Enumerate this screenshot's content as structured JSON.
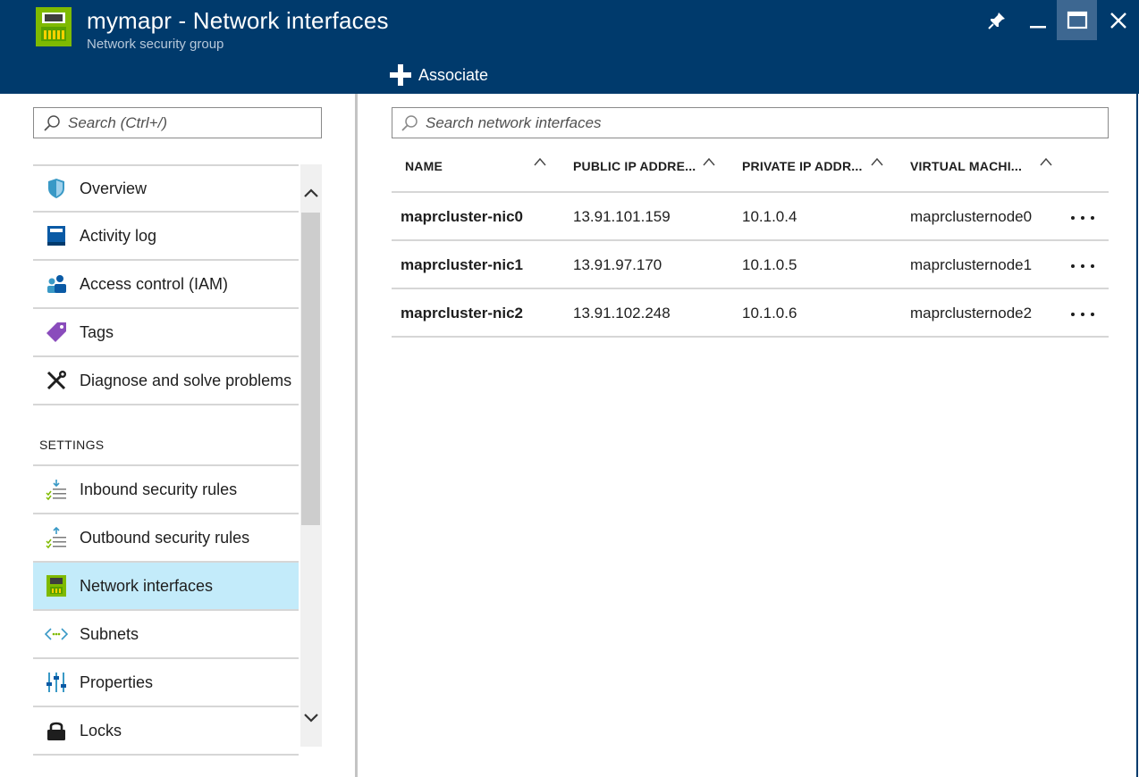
{
  "header": {
    "title": "mymapr - Network interfaces",
    "subtitle": "Network security group",
    "app_icon": "network-interface-icon",
    "window_controls": [
      "pin-icon",
      "minimize-icon",
      "maximize-icon",
      "close-icon"
    ],
    "command": {
      "label": "Associate",
      "icon": "plus-icon"
    }
  },
  "sidebar": {
    "search_placeholder": "Search (Ctrl+/)",
    "items": [
      {
        "label": "Overview",
        "icon": "shield-icon"
      },
      {
        "label": "Activity log",
        "icon": "activity-log-icon"
      },
      {
        "label": "Access control (IAM)",
        "icon": "users-icon"
      },
      {
        "label": "Tags",
        "icon": "tag-icon"
      },
      {
        "label": "Diagnose and solve problems",
        "icon": "wrench-icon"
      }
    ],
    "settings_header": "SETTINGS",
    "settings_items": [
      {
        "label": "Inbound security rules",
        "icon": "inbound-rules-icon"
      },
      {
        "label": "Outbound security rules",
        "icon": "outbound-rules-icon"
      },
      {
        "label": "Network interfaces",
        "icon": "network-interface-icon",
        "selected": true
      },
      {
        "label": "Subnets",
        "icon": "subnet-icon"
      },
      {
        "label": "Properties",
        "icon": "properties-icon"
      },
      {
        "label": "Locks",
        "icon": "lock-icon"
      }
    ]
  },
  "main": {
    "search_placeholder": "Search network interfaces",
    "columns": [
      "NAME",
      "PUBLIC IP ADDRE...",
      "PRIVATE IP ADDR...",
      "VIRTUAL MACHI..."
    ],
    "rows": [
      {
        "name": "maprcluster-nic0",
        "public_ip": "13.91.101.159",
        "private_ip": "10.1.0.4",
        "vm": "maprclusternode0"
      },
      {
        "name": "maprcluster-nic1",
        "public_ip": "13.91.97.170",
        "private_ip": "10.1.0.5",
        "vm": "maprclusternode1"
      },
      {
        "name": "maprcluster-nic2",
        "public_ip": "13.91.102.248",
        "private_ip": "10.1.0.6",
        "vm": "maprclusternode2"
      }
    ]
  },
  "colors": {
    "header_bg": "#003a6c",
    "selected_item_bg": "#c3ebfa",
    "maximize_active_bg": "#3d6791"
  }
}
